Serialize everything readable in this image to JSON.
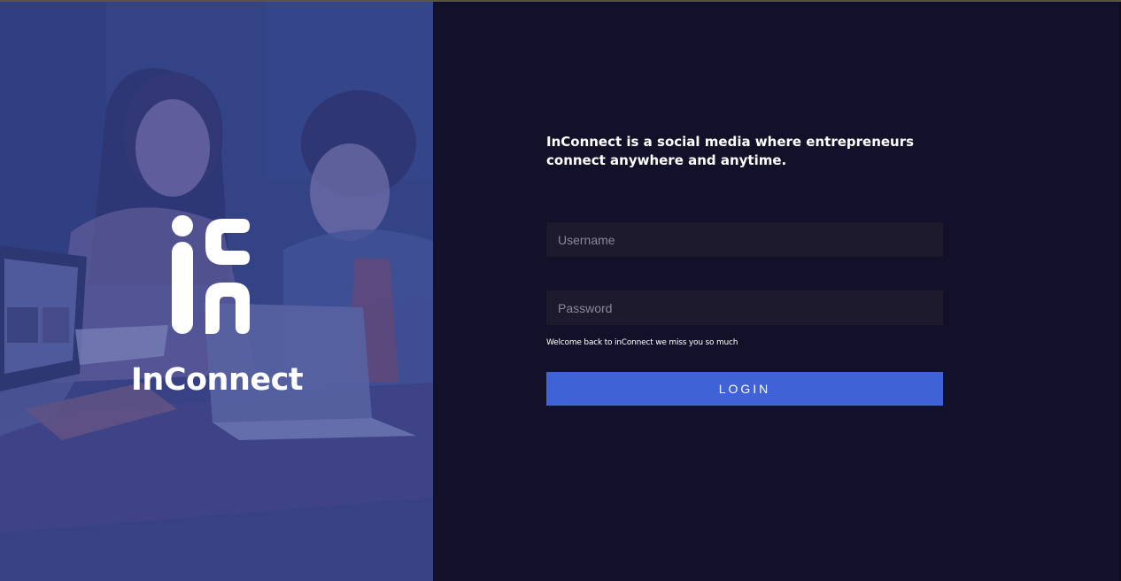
{
  "brand": {
    "name": "InConnect",
    "logo_icon": "inconnect-logo-icon"
  },
  "login": {
    "tagline": "InConnect is a social media where entrepreneurs connect anywhere and anytime.",
    "username_placeholder": "Username",
    "username_value": "",
    "password_placeholder": "Password",
    "password_value": "",
    "welcome_text": "Welcome back to inConnect we miss you so much",
    "login_button_label": "LOGIN"
  },
  "colors": {
    "accent": "#3f62d6",
    "panel_background": "#13112a",
    "input_background": "#1e1a2e",
    "hero_tint": "#34438a"
  }
}
